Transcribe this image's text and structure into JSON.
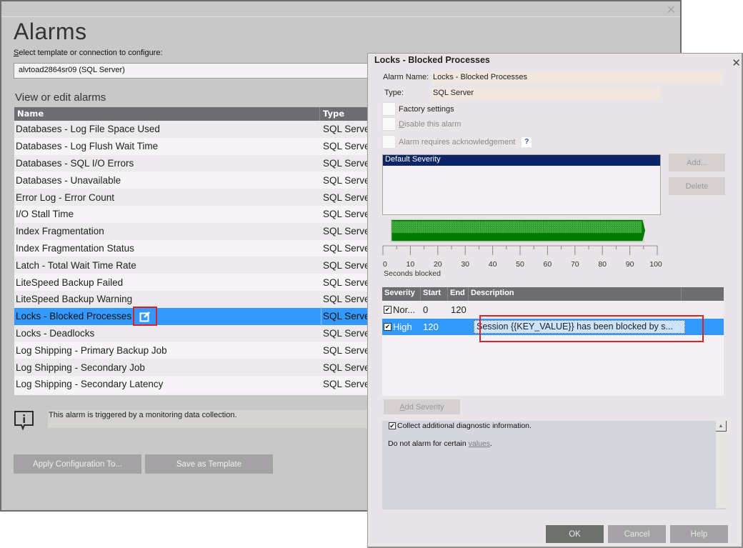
{
  "main_window": {
    "title": "Alarms",
    "select_label_prefix": "S",
    "select_label_rest": "elect template or connection to configure:",
    "connection_value": "alvtoad2864sr09 (SQL Server)",
    "section_title": "View or edit alarms",
    "table": {
      "columns": [
        "Name",
        "Type"
      ],
      "rows": [
        {
          "name": "Databases - Log File Space Used",
          "type": "SQL Serve"
        },
        {
          "name": "Databases - Log Flush Wait Time",
          "type": "SQL Serve"
        },
        {
          "name": "Databases - SQL I/O Errors",
          "type": "SQL Serve"
        },
        {
          "name": "Databases - Unavailable",
          "type": "SQL Serve"
        },
        {
          "name": "Error Log - Error Count",
          "type": "SQL Serve"
        },
        {
          "name": "I/O Stall Time",
          "type": "SQL Serve"
        },
        {
          "name": "Index Fragmentation",
          "type": "SQL Serve"
        },
        {
          "name": "Index Fragmentation Status",
          "type": "SQL Serve"
        },
        {
          "name": "Latch - Total Wait Time Rate",
          "type": "SQL Serve"
        },
        {
          "name": "LiteSpeed Backup Failed",
          "type": "SQL Serve"
        },
        {
          "name": "LiteSpeed Backup Warning",
          "type": "SQL Serve"
        },
        {
          "name": "Locks - Blocked Processes",
          "type": "SQL Serve",
          "selected": true
        },
        {
          "name": "Locks - Deadlocks",
          "type": "SQL Serve"
        },
        {
          "name": "Log Shipping - Primary Backup Job",
          "type": "SQL Serve"
        },
        {
          "name": "Log Shipping - Secondary Job",
          "type": "SQL Serve"
        },
        {
          "name": "Log Shipping - Secondary Latency",
          "type": "SQL Serve"
        }
      ]
    },
    "info_text": "This alarm is triggered by a monitoring data collection.",
    "apply_button": "Apply Configuration To...",
    "save_template_button": "Save as Template",
    "close_glyph": "✕"
  },
  "dialog": {
    "title": "Locks - Blocked Processes",
    "close_glyph": "✕",
    "alarm_name_label": "Alarm Name:",
    "alarm_name_value": "Locks - Blocked Processes",
    "type_label": "Type:",
    "type_value": "SQL Server",
    "checkboxes": {
      "factory_settings": {
        "label": "Factory settings",
        "checked": false
      },
      "disable_alarm": {
        "label_prefix": "D",
        "label_rest": "isable this alarm",
        "checked": false,
        "disabled": true
      },
      "requires_ack": {
        "label": "Alarm requires acknowledgement",
        "checked": false,
        "disabled": true
      }
    },
    "help_glyph": "?",
    "severity_list": [
      "Default Severity"
    ],
    "add_button": "Add...",
    "delete_button": "Delete",
    "gauge": {
      "ticks": [
        "0",
        "10",
        "20",
        "30",
        "40",
        "50",
        "60",
        "70",
        "80",
        "90",
        "100"
      ],
      "min": 0,
      "max": 100,
      "fill_fraction": 1.0,
      "fill_color": "#007a00",
      "label": "Seconds blocked"
    },
    "severity_table": {
      "columns": [
        "Severity",
        "Start",
        "End",
        "Description"
      ],
      "rows": [
        {
          "checked": true,
          "severity": "Nor...",
          "start": "0",
          "end": "120",
          "description": ""
        },
        {
          "checked": true,
          "severity": "High",
          "start": "120",
          "end": "",
          "description": "Session {{KEY_VALUE}} has been blocked by s...",
          "selected": true
        }
      ]
    },
    "add_severity_prefix": "A",
    "add_severity_rest": "dd Severity",
    "diagnostic": {
      "collect_label": "Collect additional diagnostic information.",
      "collect_checked": true,
      "do_not_alarm_prefix": "Do not alarm for certain ",
      "values_link": "values",
      "do_not_alarm_suffix": "."
    },
    "ok_button": "OK",
    "cancel_button": "Cancel",
    "help_button": "Help"
  },
  "colors": {
    "selection": "#3399ff",
    "highlight_box": "#d8232a",
    "list_selection": "#0d2566",
    "header_bg": "#6e6e72"
  }
}
